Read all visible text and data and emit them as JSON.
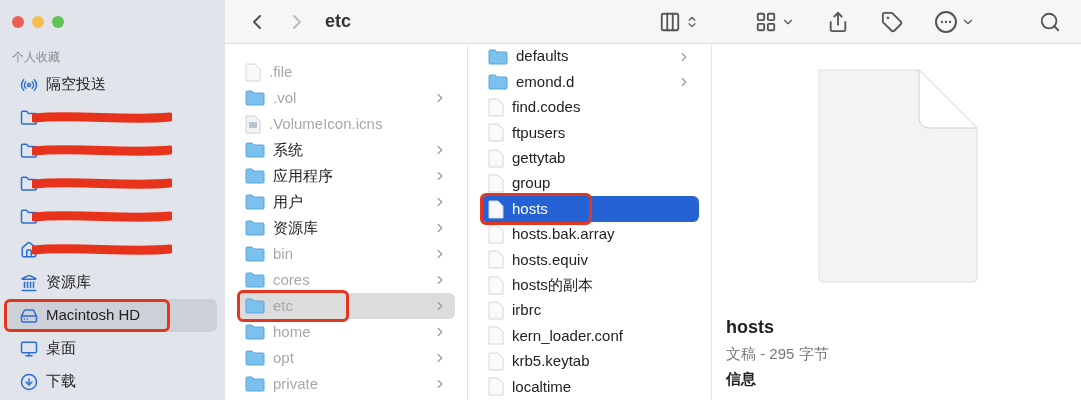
{
  "window": {
    "title": "etc"
  },
  "toolbar": {
    "back_enabled": true,
    "forward_enabled": false
  },
  "sidebar": {
    "section": "个人收藏",
    "items": [
      {
        "kind": "airdrop",
        "label": "隔空投送",
        "selected": false,
        "annotated": false
      },
      {
        "kind": "redacted",
        "selected": false,
        "annotated": false
      },
      {
        "kind": "redacted",
        "selected": false,
        "annotated": false
      },
      {
        "kind": "redacted",
        "selected": false,
        "annotated": false
      },
      {
        "kind": "redacted",
        "selected": false,
        "annotated": false
      },
      {
        "kind": "redacted-home",
        "selected": false,
        "annotated": false
      },
      {
        "kind": "library",
        "label": "资源库",
        "selected": false,
        "annotated": false
      },
      {
        "kind": "disk",
        "label": "Macintosh HD",
        "selected": true,
        "annotated": true
      },
      {
        "kind": "desktop",
        "label": "桌面",
        "selected": false,
        "annotated": false
      },
      {
        "kind": "download",
        "label": "下载",
        "selected": false,
        "annotated": false
      }
    ]
  },
  "columns": [
    {
      "items": [
        {
          "kind": "file",
          "name": ".file",
          "dimmed": true,
          "selected": false,
          "annotated": false
        },
        {
          "kind": "folder",
          "name": ".vol",
          "dimmed": true,
          "selected": false,
          "annotated": false
        },
        {
          "kind": "image",
          "name": ".VolumeIcon.icns",
          "dimmed": true,
          "selected": false,
          "annotated": false
        },
        {
          "kind": "folder",
          "name": "系统",
          "dimmed": false,
          "selected": false,
          "annotated": false
        },
        {
          "kind": "folder",
          "name": "应用程序",
          "dimmed": false,
          "selected": false,
          "annotated": false
        },
        {
          "kind": "folder",
          "name": "用户",
          "dimmed": false,
          "selected": false,
          "annotated": false
        },
        {
          "kind": "folder",
          "name": "资源库",
          "dimmed": false,
          "selected": false,
          "annotated": false
        },
        {
          "kind": "folder",
          "name": "bin",
          "dimmed": true,
          "selected": false,
          "annotated": false
        },
        {
          "kind": "folder",
          "name": "cores",
          "dimmed": true,
          "selected": false,
          "annotated": false
        },
        {
          "kind": "folder",
          "name": "etc",
          "dimmed": true,
          "selected": true,
          "annotated": true
        },
        {
          "kind": "folder",
          "name": "home",
          "dimmed": true,
          "selected": false,
          "annotated": false
        },
        {
          "kind": "folder",
          "name": "opt",
          "dimmed": true,
          "selected": false,
          "annotated": false
        },
        {
          "kind": "folder",
          "name": "private",
          "dimmed": true,
          "selected": false,
          "annotated": false
        }
      ]
    },
    {
      "items": [
        {
          "kind": "folder",
          "name": "defaults",
          "dimmed": false,
          "selected": false,
          "annotated": false
        },
        {
          "kind": "folder",
          "name": "emond.d",
          "dimmed": false,
          "selected": false,
          "annotated": false
        },
        {
          "kind": "file",
          "name": "find.codes",
          "dimmed": false,
          "selected": false,
          "annotated": false
        },
        {
          "kind": "file",
          "name": "ftpusers",
          "dimmed": false,
          "selected": false,
          "annotated": false
        },
        {
          "kind": "file",
          "name": "gettytab",
          "dimmed": false,
          "selected": false,
          "annotated": false
        },
        {
          "kind": "file",
          "name": "group",
          "dimmed": false,
          "selected": false,
          "annotated": false
        },
        {
          "kind": "file",
          "name": "hosts",
          "dimmed": false,
          "selected": true,
          "annotated": true
        },
        {
          "kind": "file",
          "name": "hosts.bak.array",
          "dimmed": false,
          "selected": false,
          "annotated": false
        },
        {
          "kind": "file",
          "name": "hosts.equiv",
          "dimmed": false,
          "selected": false,
          "annotated": false
        },
        {
          "kind": "file",
          "name": "hosts的副本",
          "dimmed": false,
          "selected": false,
          "annotated": false
        },
        {
          "kind": "file",
          "name": "irbrc",
          "dimmed": false,
          "selected": false,
          "annotated": false
        },
        {
          "kind": "file",
          "name": "kern_loader.conf",
          "dimmed": false,
          "selected": false,
          "annotated": false
        },
        {
          "kind": "file",
          "name": "krb5.keytab",
          "dimmed": false,
          "selected": false,
          "annotated": false
        },
        {
          "kind": "file",
          "name": "localtime",
          "dimmed": false,
          "selected": false,
          "annotated": false
        }
      ]
    }
  ],
  "preview": {
    "name": "hosts",
    "meta": "文稿 - 295 字节",
    "section": "信息"
  }
}
